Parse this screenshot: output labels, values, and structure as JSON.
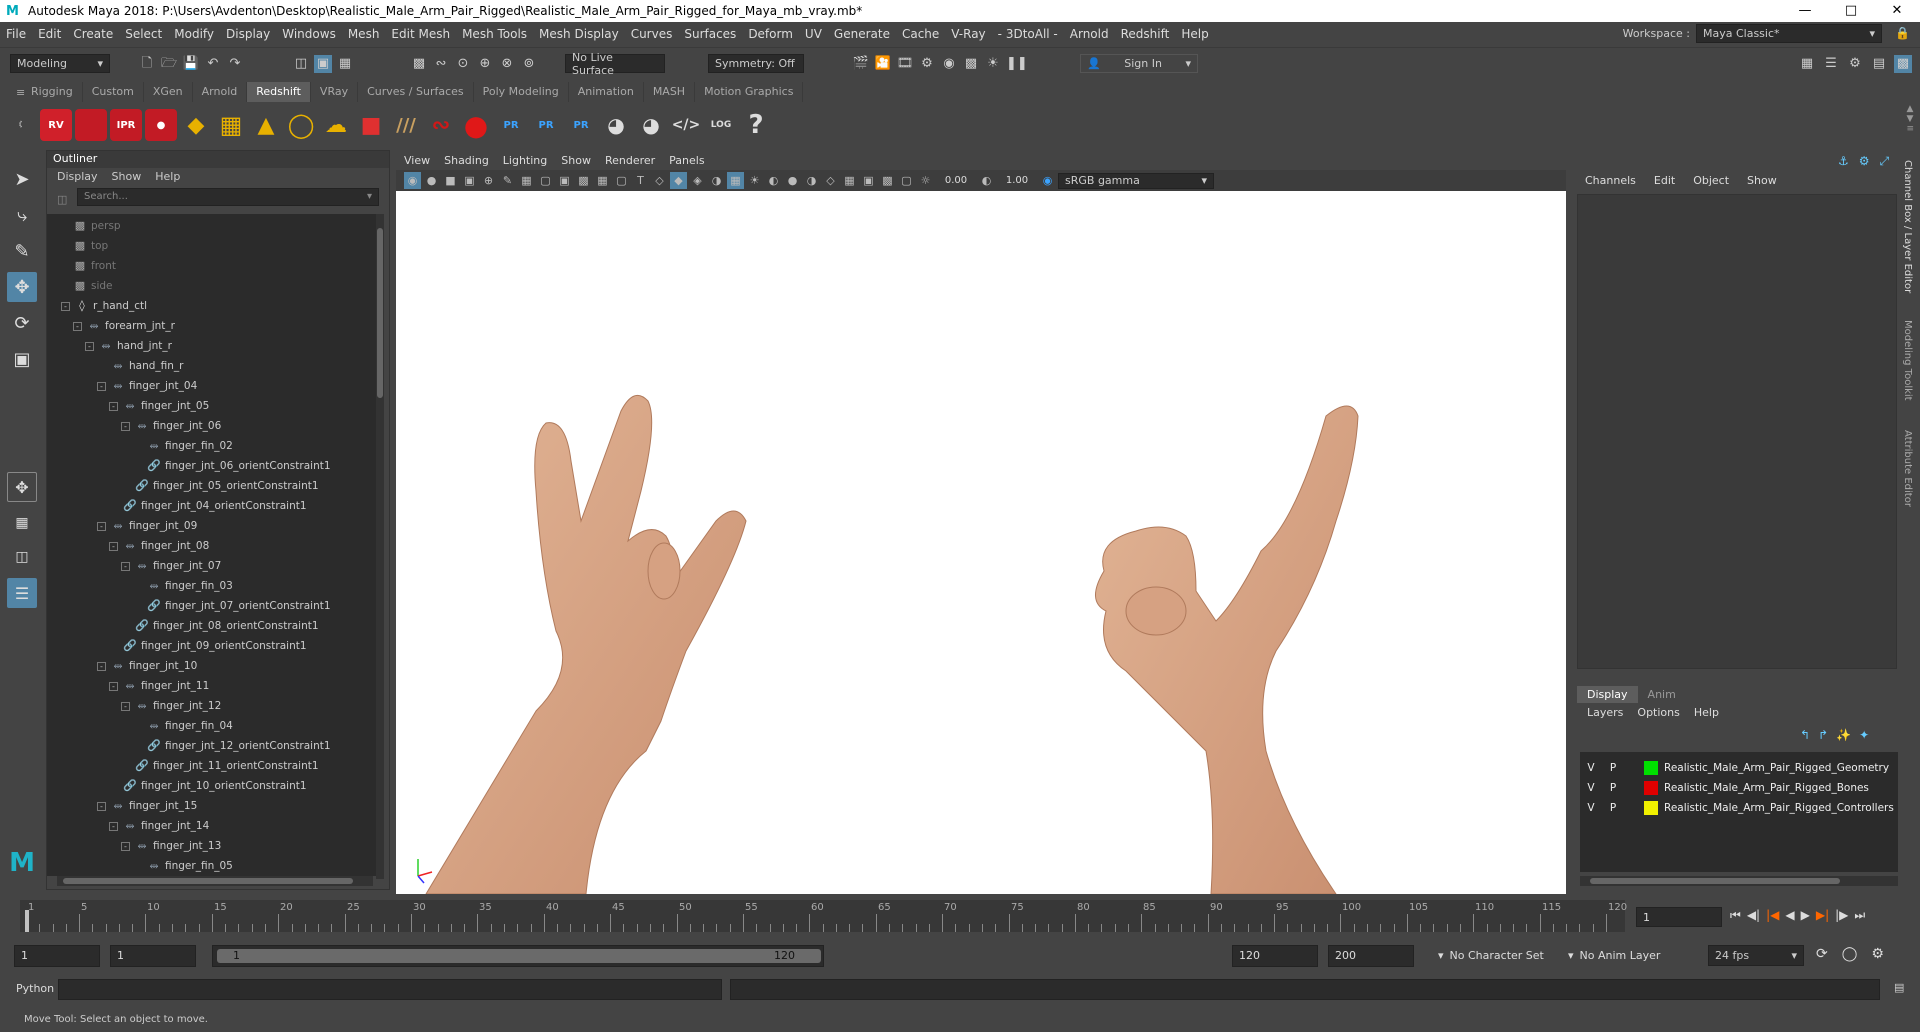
{
  "title": "Autodesk Maya 2018: P:\\Users\\Avdenton\\Desktop\\Realistic_Male_Arm_Pair_Rigged\\Realistic_Male_Arm_Pair_Rigged_for_Maya_mb_vray.mb*",
  "menu": [
    "File",
    "Edit",
    "Create",
    "Select",
    "Modify",
    "Display",
    "Windows",
    "Mesh",
    "Edit Mesh",
    "Mesh Tools",
    "Mesh Display",
    "Curves",
    "Surfaces",
    "Deform",
    "UV",
    "Generate",
    "Cache",
    "V-Ray",
    "- 3DtoAll -",
    "Arnold",
    "Redshift",
    "Help"
  ],
  "workspace_label": "Workspace :",
  "workspace_value": "Maya Classic*",
  "status": {
    "mode": "Modeling",
    "live_surface": "No Live Surface",
    "symmetry": "Symmetry: Off",
    "sign_in": "Sign In"
  },
  "shelf_tabs": [
    "Rigging",
    "Custom",
    "XGen",
    "Arnold",
    "Redshift",
    "VRay",
    "Curves / Surfaces",
    "Poly Modeling",
    "Animation",
    "MASH",
    "Motion Graphics"
  ],
  "shelf_active": "Redshift",
  "shelf_icons": [
    "redshift-rv",
    "redshift-render",
    "redshift-ipr",
    "redshift-stop",
    "redshift-plane",
    "redshift-grid",
    "redshift-cone-light",
    "redshift-dome",
    "redshift-sun",
    "redshift-proxy",
    "redshift-hair",
    "redshift-curve",
    "redshift-sphere",
    "redshift-pr1",
    "redshift-pr2",
    "redshift-pr3",
    "redshift-bowl1",
    "redshift-bowl2",
    "redshift-code",
    "redshift-log",
    "help"
  ],
  "outliner": {
    "title": "Outliner",
    "menu": [
      "Display",
      "Show",
      "Help"
    ],
    "search_placeholder": "Search...",
    "items": [
      {
        "label": "persp",
        "depth": 0,
        "type": "camera",
        "dim": true,
        "expand": ""
      },
      {
        "label": "top",
        "depth": 0,
        "type": "camera",
        "dim": true,
        "expand": ""
      },
      {
        "label": "front",
        "depth": 0,
        "type": "camera",
        "dim": true,
        "expand": ""
      },
      {
        "label": "side",
        "depth": 0,
        "type": "camera",
        "dim": true,
        "expand": ""
      },
      {
        "label": "r_hand_ctl",
        "depth": 0,
        "type": "ctrl",
        "dim": false,
        "expand": "-"
      },
      {
        "label": "forearm_jnt_r",
        "depth": 1,
        "type": "joint",
        "dim": false,
        "expand": "-"
      },
      {
        "label": "hand_jnt_r",
        "depth": 2,
        "type": "joint",
        "dim": false,
        "expand": "-"
      },
      {
        "label": "hand_fin_r",
        "depth": 3,
        "type": "joint",
        "dim": false,
        "expand": ""
      },
      {
        "label": "finger_jnt_04",
        "depth": 3,
        "type": "joint",
        "dim": false,
        "expand": "-"
      },
      {
        "label": "finger_jnt_05",
        "depth": 4,
        "type": "joint",
        "dim": false,
        "expand": "-"
      },
      {
        "label": "finger_jnt_06",
        "depth": 5,
        "type": "joint",
        "dim": false,
        "expand": "-"
      },
      {
        "label": "finger_fin_02",
        "depth": 6,
        "type": "joint",
        "dim": false,
        "expand": ""
      },
      {
        "label": "finger_jnt_06_orientConstraint1",
        "depth": 6,
        "type": "constraint",
        "dim": false,
        "expand": ""
      },
      {
        "label": "finger_jnt_05_orientConstraint1",
        "depth": 5,
        "type": "constraint",
        "dim": false,
        "expand": ""
      },
      {
        "label": "finger_jnt_04_orientConstraint1",
        "depth": 4,
        "type": "constraint",
        "dim": false,
        "expand": ""
      },
      {
        "label": "finger_jnt_09",
        "depth": 3,
        "type": "joint",
        "dim": false,
        "expand": "-"
      },
      {
        "label": "finger_jnt_08",
        "depth": 4,
        "type": "joint",
        "dim": false,
        "expand": "-"
      },
      {
        "label": "finger_jnt_07",
        "depth": 5,
        "type": "joint",
        "dim": false,
        "expand": "-"
      },
      {
        "label": "finger_fin_03",
        "depth": 6,
        "type": "joint",
        "dim": false,
        "expand": ""
      },
      {
        "label": "finger_jnt_07_orientConstraint1",
        "depth": 6,
        "type": "constraint",
        "dim": false,
        "expand": ""
      },
      {
        "label": "finger_jnt_08_orientConstraint1",
        "depth": 5,
        "type": "constraint",
        "dim": false,
        "expand": ""
      },
      {
        "label": "finger_jnt_09_orientConstraint1",
        "depth": 4,
        "type": "constraint",
        "dim": false,
        "expand": ""
      },
      {
        "label": "finger_jnt_10",
        "depth": 3,
        "type": "joint",
        "dim": false,
        "expand": "-"
      },
      {
        "label": "finger_jnt_11",
        "depth": 4,
        "type": "joint",
        "dim": false,
        "expand": "-"
      },
      {
        "label": "finger_jnt_12",
        "depth": 5,
        "type": "joint",
        "dim": false,
        "expand": "-"
      },
      {
        "label": "finger_fin_04",
        "depth": 6,
        "type": "joint",
        "dim": false,
        "expand": ""
      },
      {
        "label": "finger_jnt_12_orientConstraint1",
        "depth": 6,
        "type": "constraint",
        "dim": false,
        "expand": ""
      },
      {
        "label": "finger_jnt_11_orientConstraint1",
        "depth": 5,
        "type": "constraint",
        "dim": false,
        "expand": ""
      },
      {
        "label": "finger_jnt_10_orientConstraint1",
        "depth": 4,
        "type": "constraint",
        "dim": false,
        "expand": ""
      },
      {
        "label": "finger_jnt_15",
        "depth": 3,
        "type": "joint",
        "dim": false,
        "expand": "-"
      },
      {
        "label": "finger_jnt_14",
        "depth": 4,
        "type": "joint",
        "dim": false,
        "expand": "-"
      },
      {
        "label": "finger_jnt_13",
        "depth": 5,
        "type": "joint",
        "dim": false,
        "expand": "-"
      },
      {
        "label": "finger_fin_05",
        "depth": 6,
        "type": "joint",
        "dim": false,
        "expand": ""
      }
    ]
  },
  "viewport": {
    "menu": [
      "View",
      "Shading",
      "Lighting",
      "Show",
      "Renderer",
      "Panels"
    ],
    "exposure": "0.00",
    "gamma": "1.00",
    "color_space": "sRGB gamma",
    "background": "#ffffff"
  },
  "channel_box": {
    "menu": [
      "Channels",
      "Edit",
      "Object",
      "Show"
    ]
  },
  "side_tabs": [
    "Channel Box / Layer Editor",
    "Modeling Toolkit",
    "Attribute Editor"
  ],
  "layer_editor": {
    "tabs": [
      "Display",
      "Anim"
    ],
    "menu": [
      "Layers",
      "Options",
      "Help"
    ],
    "layers": [
      {
        "v": "V",
        "p": "P",
        "color": "#00e000",
        "name": "Realistic_Male_Arm_Pair_Rigged_Geometry"
      },
      {
        "v": "V",
        "p": "P",
        "color": "#e00000",
        "name": "Realistic_Male_Arm_Pair_Rigged_Bones"
      },
      {
        "v": "V",
        "p": "P",
        "color": "#f0f000",
        "name": "Realistic_Male_Arm_Pair_Rigged_Controllers"
      }
    ]
  },
  "timeline": {
    "labels": [
      "1",
      "5",
      "10",
      "15",
      "20",
      "25",
      "30",
      "35",
      "40",
      "45",
      "50",
      "55",
      "60",
      "65",
      "70",
      "75",
      "80",
      "85",
      "90",
      "95",
      "100",
      "105",
      "110",
      "115",
      "120"
    ],
    "current_frame": "1"
  },
  "range": {
    "start": "1",
    "anim_start": "1",
    "range_start": "1",
    "range_end": "120",
    "end": "120",
    "anim_end": "200",
    "character_set": "No Character Set",
    "anim_layer": "No Anim Layer",
    "fps": "24 fps"
  },
  "cmd": {
    "lang": "Python"
  },
  "help_line": "Move Tool: Select an object to move."
}
